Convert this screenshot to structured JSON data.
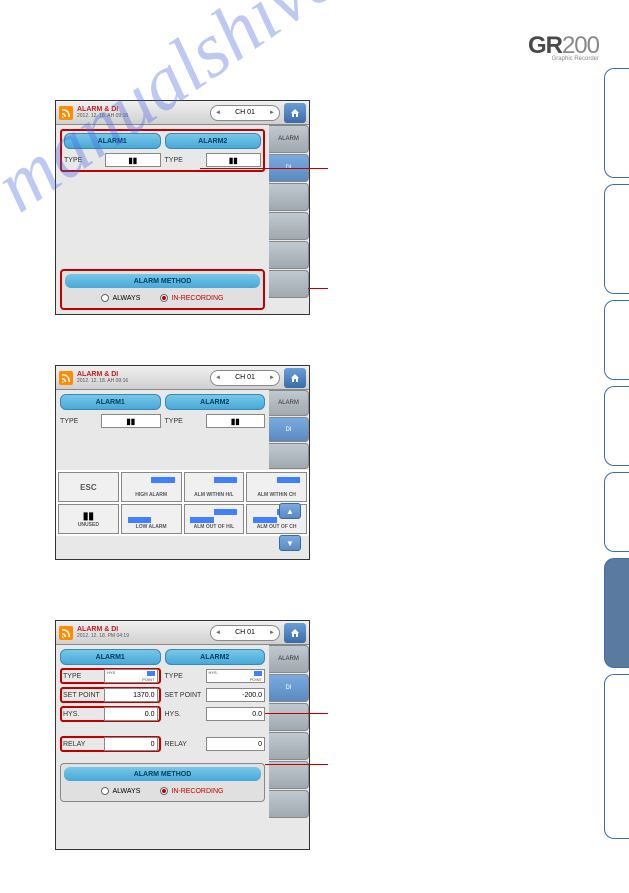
{
  "logo": {
    "brand_pre": "GR",
    "brand_post": "200",
    "subtitle": "Graphic Recorder"
  },
  "watermark": "manualshive.com",
  "side_tab_heights": [
    110,
    110,
    80,
    80,
    80,
    110,
    165
  ],
  "filled_tab_index": 5,
  "common": {
    "ch": "CH 01",
    "alarm1": "ALARM1",
    "alarm2": "ALARM2",
    "type": "TYPE",
    "alarm_method": "ALARM METHOD",
    "always": "ALWAYS",
    "in_recording": "IN-RECORDING",
    "rtab_alarm": "ALARM",
    "rtab_di": "DI"
  },
  "s1": {
    "title": "ALARM & DI",
    "time": "2012. 12. 18.  AH 09:16"
  },
  "s2": {
    "title": "ALARM & DI",
    "time": "2012. 12. 18.  AH 09:16",
    "popup": {
      "esc": "ESC",
      "unused": "UNUSED",
      "high": "HIGH ALARM",
      "low": "LOW ALARM",
      "within_hl": "ALM WITHIN H/L",
      "out_hl": "ALM OUT OF H/L",
      "within_ch": "ALM WITHIN CH",
      "out_ch": "ALM OUT OF CH"
    }
  },
  "s3": {
    "title": "ALARM & DI",
    "time": "2012. 12. 18.  PM 04:19",
    "set_point": "SET POINT",
    "hys": "HYS.",
    "relay": "RELAY",
    "sp1": "1370.0",
    "sp2": "-200.0",
    "hys1": "0.0",
    "hys2": "0.0",
    "relay1": "0",
    "relay2": "0",
    "type_hys": "HYS",
    "type_point": "POINT"
  }
}
